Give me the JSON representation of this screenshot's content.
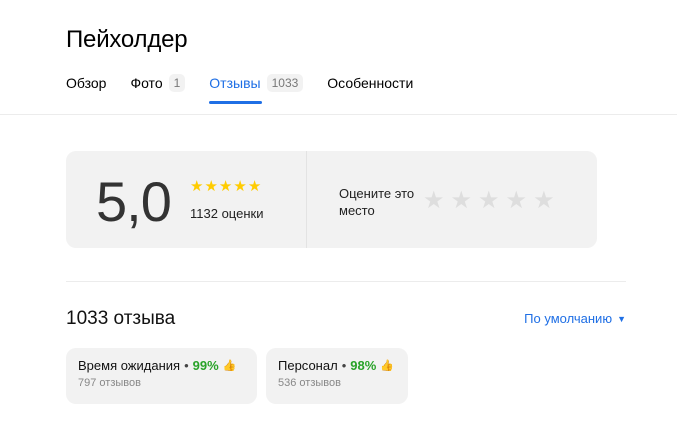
{
  "place": {
    "title": "Пейхолдер"
  },
  "tabs": [
    {
      "label": "Обзор",
      "count": ""
    },
    {
      "label": "Фото",
      "count": "1"
    },
    {
      "label": "Отзывы",
      "count": "1033"
    },
    {
      "label": "Особенности",
      "count": ""
    }
  ],
  "rating": {
    "score": "5,0",
    "stars_filled": 5,
    "count_text": "1132 оценки",
    "rate_prompt": "Оцените это место",
    "rate_stars": 5
  },
  "reviews": {
    "title": "1033 отзыва",
    "sort_label": "По умолчанию"
  },
  "aspects": [
    {
      "name": "Время ожидания",
      "percent": "99%",
      "count": "797 отзывов"
    },
    {
      "name": "Персонал",
      "percent": "98%",
      "count": "536 отзывов"
    }
  ],
  "colors": {
    "accent": "#1f6fe5",
    "star": "#ffcc00",
    "positive": "#29a329"
  }
}
